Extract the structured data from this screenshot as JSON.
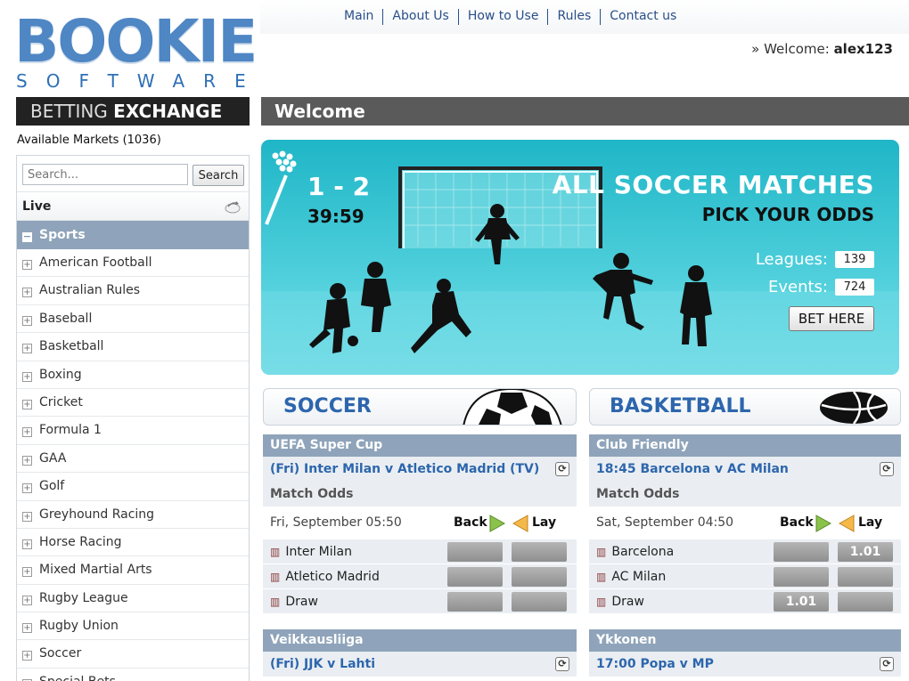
{
  "brand": {
    "name": "BOOKIE",
    "tagline": "SOFTWARE",
    "color": "#4f86c4"
  },
  "nav": {
    "items": [
      "Main",
      "About Us",
      "How to Use",
      "Rules",
      "Contact us"
    ]
  },
  "user": {
    "prefix": "» Welcome:",
    "name": "alex123"
  },
  "sidebar": {
    "header_thin": "BETTING",
    "header_bold": "EXCHANGE",
    "available": "Available Markets (1036)",
    "search_placeholder": "Search...",
    "search_button": "Search",
    "live_label": "Live",
    "sports_label": "Sports",
    "sports": [
      "American Football",
      "Australian Rules",
      "Baseball",
      "Basketball",
      "Boxing",
      "Cricket",
      "Formula 1",
      "GAA",
      "Golf",
      "Greyhound Racing",
      "Horse Racing",
      "Mixed Martial Arts",
      "Rugby League",
      "Rugby Union",
      "Soccer",
      "Special Bets"
    ]
  },
  "main": {
    "title": "Welcome",
    "banner": {
      "score": "1 - 2",
      "clock": "39:59",
      "headline": "ALL SOCCER MATCHES",
      "subhead": "PICK YOUR ODDS",
      "leagues_label": "Leagues:",
      "leagues_value": "139",
      "events_label": "Events:",
      "events_value": "724",
      "cta": "BET HERE"
    },
    "panels": [
      {
        "title": "SOCCER",
        "competitions": [
          {
            "name": "UEFA Super Cup",
            "match": "(Fri) Inter Milan v Atletico Madrid (TV)",
            "market": "Match Odds",
            "datetime": "Fri, September 05:50",
            "back": "Back",
            "lay": "Lay",
            "selections": [
              {
                "name": "Inter Milan",
                "back": "",
                "lay": ""
              },
              {
                "name": "Atletico Madrid",
                "back": "",
                "lay": ""
              },
              {
                "name": "Draw",
                "back": "",
                "lay": ""
              }
            ]
          },
          {
            "name": "Veikkausliiga",
            "match": "(Fri) JJK v Lahti"
          }
        ]
      },
      {
        "title": "BASKETBALL",
        "competitions": [
          {
            "name": "Club Friendly",
            "match": "18:45 Barcelona v AC Milan",
            "market": "Match Odds",
            "datetime": "Sat, September 04:50",
            "back": "Back",
            "lay": "Lay",
            "selections": [
              {
                "name": "Barcelona",
                "back": "",
                "lay": "1.01"
              },
              {
                "name": "AC Milan",
                "back": "",
                "lay": ""
              },
              {
                "name": "Draw",
                "back": "1.01",
                "lay": ""
              }
            ]
          },
          {
            "name": "Ykkonen",
            "match": "17:00 Popa v MP"
          }
        ]
      }
    ]
  }
}
